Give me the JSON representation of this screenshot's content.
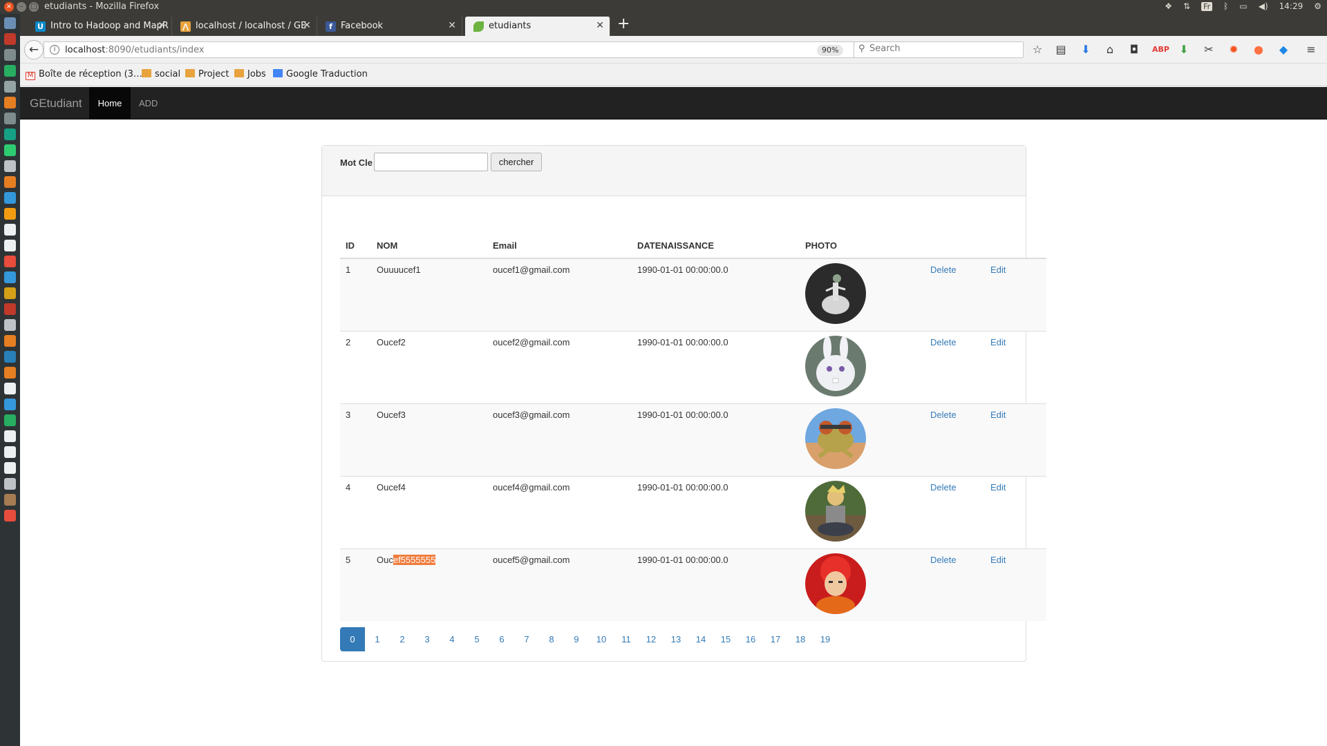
{
  "os": {
    "window_title": "etudiants - Mozilla Firefox",
    "clock": "14:29",
    "keyboard": "Fr"
  },
  "browser": {
    "tabs": [
      {
        "label": "Intro to Hadoop and MapR",
        "icon": "udacity-icon"
      },
      {
        "label": "localhost / localhost / GE",
        "icon": "phpmyadmin-icon"
      },
      {
        "label": "Facebook",
        "icon": "facebook-icon"
      },
      {
        "label": "etudiants",
        "icon": "spring-leaf-icon",
        "active": true
      }
    ],
    "url_host": "localhost",
    "url_rest": ":8090/etudiants/index",
    "zoom": "90%",
    "search_placeholder": "Search",
    "bookmarks": [
      {
        "label": "Boîte de réception (3…",
        "icon": "gmail-icon"
      },
      {
        "label": "social",
        "icon": "folder-icon"
      },
      {
        "label": "Project",
        "icon": "folder-icon"
      },
      {
        "label": "Jobs",
        "icon": "folder-icon"
      },
      {
        "label": "Google Traduction",
        "icon": "google-translate-icon"
      }
    ]
  },
  "app": {
    "brand": "GEtudiant",
    "nav": {
      "home": "Home",
      "add": "ADD"
    },
    "search": {
      "label": "Mot Cle",
      "value": "",
      "button": "chercher"
    },
    "table": {
      "headers": [
        "ID",
        "NOM",
        "Email",
        "DATENAISSANCE",
        "PHOTO"
      ],
      "rows": [
        {
          "id": "1",
          "nom": "Ouuuucef1",
          "email": "oucef1@gmail.com",
          "date": "1990-01-01 00:00:00.0",
          "photo": "ballerina-photo"
        },
        {
          "id": "2",
          "nom": "Oucef2",
          "email": "oucef2@gmail.com",
          "date": "1990-01-01 00:00:00.0",
          "photo": "white-rabbit-photo"
        },
        {
          "id": "3",
          "nom": "Oucef3",
          "email": "oucef3@gmail.com",
          "date": "1990-01-01 00:00:00.0",
          "photo": "frog-photo"
        },
        {
          "id": "4",
          "nom": "Oucef4",
          "email": "oucef4@gmail.com",
          "date": "1990-01-01 00:00:00.0",
          "photo": "ninja-photo"
        },
        {
          "id": "5",
          "nom_pre": "Ouc",
          "nom_sel": "ef5555555",
          "email": "oucef5@gmail.com",
          "date": "1990-01-01 00:00:00.0",
          "photo": "red-hair-photo"
        }
      ],
      "delete_label": "Delete",
      "edit_label": "Edit"
    },
    "pages": [
      "0",
      "1",
      "2",
      "3",
      "4",
      "5",
      "6",
      "7",
      "8",
      "9",
      "10",
      "11",
      "12",
      "13",
      "14",
      "15",
      "16",
      "17",
      "18",
      "19"
    ],
    "current_page": "0"
  },
  "colors": {
    "link": "#337ab7",
    "navbar": "#222222",
    "selection": "#f07c3c",
    "ubuntu_orange": "#e95420"
  }
}
